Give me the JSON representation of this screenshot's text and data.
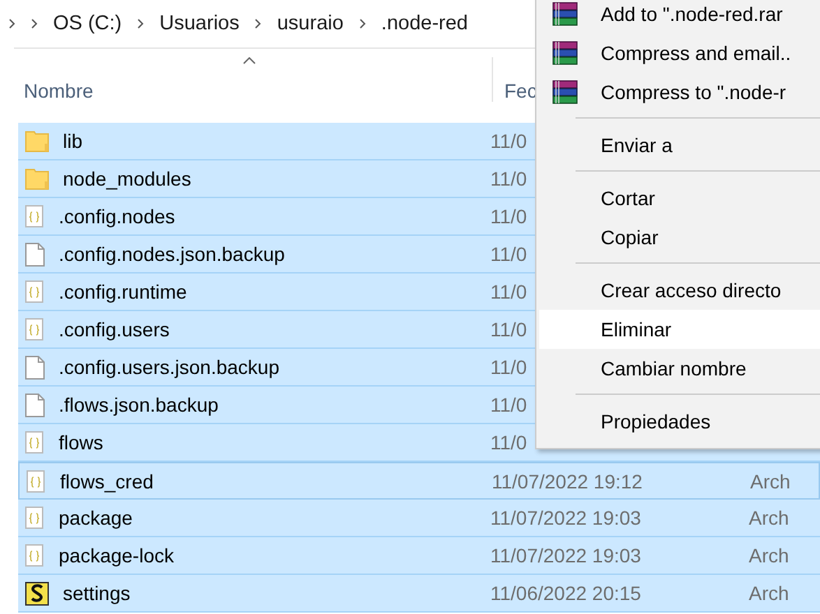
{
  "breadcrumb": [
    {
      "label": "OS (C:)"
    },
    {
      "label": "Usuarios"
    },
    {
      "label": "usuraio"
    },
    {
      "label": ".node-red"
    }
  ],
  "columns": {
    "name": "Nombre",
    "date": "Fec"
  },
  "rows": [
    {
      "kind": "folder",
      "name": "lib",
      "date": "11/0",
      "type": "",
      "selected": true,
      "focused": false
    },
    {
      "kind": "folder",
      "name": "node_modules",
      "date": "11/0",
      "type": "",
      "selected": true,
      "focused": false
    },
    {
      "kind": "json",
      "name": ".config.nodes",
      "date": "11/0",
      "type": "",
      "selected": true,
      "focused": false
    },
    {
      "kind": "file",
      "name": ".config.nodes.json.backup",
      "date": "11/0",
      "type": "",
      "selected": true,
      "focused": false
    },
    {
      "kind": "json",
      "name": ".config.runtime",
      "date": "11/0",
      "type": "",
      "selected": true,
      "focused": false
    },
    {
      "kind": "json",
      "name": ".config.users",
      "date": "11/0",
      "type": "",
      "selected": true,
      "focused": false
    },
    {
      "kind": "file",
      "name": ".config.users.json.backup",
      "date": "11/0",
      "type": "",
      "selected": true,
      "focused": false
    },
    {
      "kind": "file",
      "name": ".flows.json.backup",
      "date": "11/0",
      "type": "",
      "selected": true,
      "focused": false
    },
    {
      "kind": "json",
      "name": "flows",
      "date": "11/0",
      "type": "",
      "selected": true,
      "focused": false
    },
    {
      "kind": "json",
      "name": "flows_cred",
      "date": "11/07/2022 19:12",
      "type": "Arch",
      "selected": true,
      "focused": true
    },
    {
      "kind": "json",
      "name": "package",
      "date": "11/07/2022 19:03",
      "type": "Arch",
      "selected": true,
      "focused": false
    },
    {
      "kind": "json",
      "name": "package-lock",
      "date": "11/07/2022 19:03",
      "type": "Arch",
      "selected": true,
      "focused": false
    },
    {
      "kind": "settings",
      "name": "settings",
      "date": "11/06/2022 20:15",
      "type": "Arch",
      "selected": true,
      "focused": false
    }
  ],
  "context_menu": [
    {
      "kind": "archive",
      "label": "Add to \".node-red.rar",
      "selected": false
    },
    {
      "kind": "archive",
      "label": "Compress and email..",
      "selected": false
    },
    {
      "kind": "archive",
      "label": "Compress to \".node-r",
      "selected": false
    },
    {
      "kind": "separator"
    },
    {
      "kind": "item",
      "label": "Enviar a",
      "selected": false
    },
    {
      "kind": "separator"
    },
    {
      "kind": "item",
      "label": "Cortar",
      "selected": false
    },
    {
      "kind": "item",
      "label": "Copiar",
      "selected": false
    },
    {
      "kind": "separator"
    },
    {
      "kind": "item",
      "label": "Crear acceso directo",
      "selected": false
    },
    {
      "kind": "item",
      "label": "Eliminar",
      "selected": true
    },
    {
      "kind": "item",
      "label": "Cambiar nombre",
      "selected": false
    },
    {
      "kind": "separator"
    },
    {
      "kind": "item",
      "label": "Propiedades",
      "selected": false
    }
  ]
}
